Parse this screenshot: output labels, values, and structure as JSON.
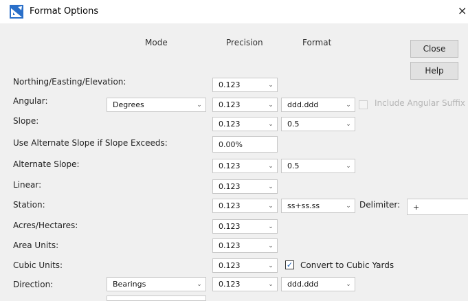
{
  "window": {
    "title": "Format Options",
    "close_glyph": "×",
    "icon": "pen-triangle-icon"
  },
  "columns": {
    "mode": "Mode",
    "precision": "Precision",
    "format": "Format"
  },
  "buttons": {
    "close": "Close",
    "help": "Help"
  },
  "rows": {
    "northing": {
      "label": "Northing/Easting/Elevation:",
      "precision": "0.123"
    },
    "angular": {
      "label": "Angular:",
      "mode": "Degrees",
      "precision": "0.123",
      "format": "ddd.ddd",
      "suffix_label": "Include Angular Suffix",
      "suffix_checked": false
    },
    "slope": {
      "label": "Slope:",
      "precision": "0.123",
      "format": "0.5"
    },
    "use_alt_slope": {
      "label": "Use Alternate Slope if Slope Exceeds:",
      "value": "0.00%"
    },
    "alt_slope": {
      "label": "Alternate Slope:",
      "precision": "0.123",
      "format": "0.5"
    },
    "linear": {
      "label": "Linear:",
      "precision": "0.123"
    },
    "station": {
      "label": "Station:",
      "precision": "0.123",
      "format": "ss+ss.ss",
      "delimiter_label": "Delimiter:",
      "delimiter_value": "+"
    },
    "acres": {
      "label": "Acres/Hectares:",
      "precision": "0.123"
    },
    "area": {
      "label": "Area Units:",
      "precision": "0.123"
    },
    "cubic": {
      "label": "Cubic Units:",
      "precision": "0.123",
      "convert_label": "Convert to Cubic Yards",
      "convert_checked": true
    },
    "direction": {
      "label": "Direction:",
      "mode": "Bearings",
      "precision": "0.123",
      "format": "ddd.ddd"
    }
  },
  "colors": {
    "accent": "#1a5fb4",
    "disabled": "#b5b5b5"
  }
}
